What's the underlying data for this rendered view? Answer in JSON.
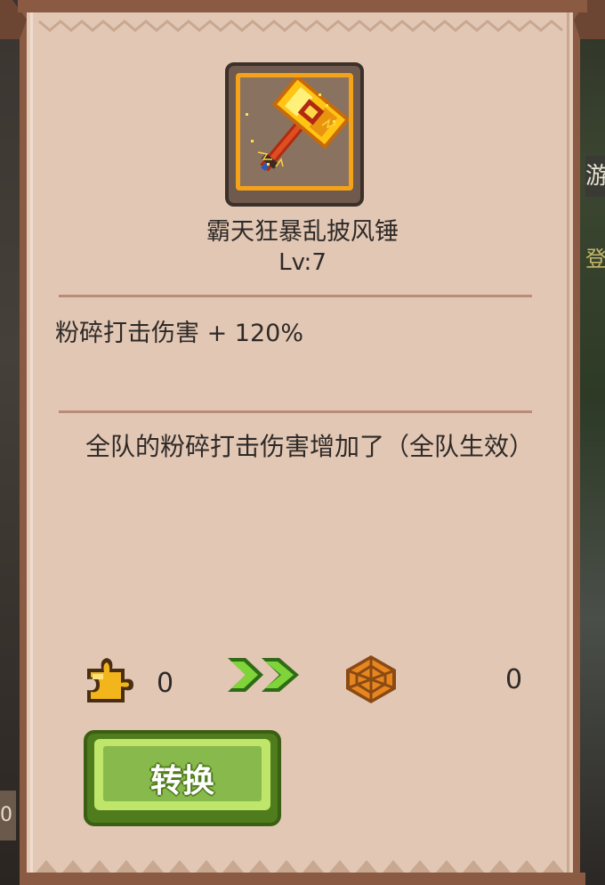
{
  "item": {
    "name": "霸天狂暴乱披风锤",
    "level": "Lv:7",
    "icon": "golden-hammer-icon"
  },
  "stat": {
    "text": "粉碎打击伤害 + 120%"
  },
  "description": "全队的粉碎打击伤害增加了（全队生效）",
  "conversion": {
    "source_icon": "puzzle-piece-icon",
    "source_count": "0",
    "arrow_icon": "double-chevron-right-icon",
    "target_icon": "orange-web-token-icon",
    "target_count": "0"
  },
  "convert_button": {
    "label": "转换"
  },
  "background": {
    "left_fragment": "0",
    "right_fragment_1": "游",
    "right_fragment_2": "登"
  },
  "colors": {
    "panel": "#e2c7b4",
    "border": "#8a5a43",
    "item_frame": "#f5a21b",
    "button_green": "#88b94c",
    "text": "#2e2a28"
  }
}
